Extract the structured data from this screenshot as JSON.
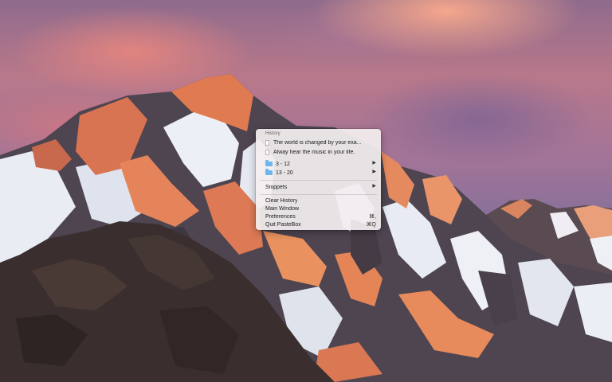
{
  "menu": {
    "header": "History",
    "history_items": [
      {
        "label": "The world is changed by your exa...",
        "icon": "document-icon"
      },
      {
        "label": "Alway hear the music in your life.",
        "icon": "document-icon"
      }
    ],
    "folders": [
      {
        "label": "3 - 12",
        "icon": "folder-icon",
        "submenu_arrow": "▶"
      },
      {
        "label": "13 - 20",
        "icon": "folder-icon",
        "submenu_arrow": "▶"
      }
    ],
    "snippets": {
      "label": "Snippets",
      "submenu_arrow": "▶"
    },
    "actions": [
      {
        "label": "Clear History",
        "shortcut": ""
      },
      {
        "label": "Main Window",
        "shortcut": ""
      },
      {
        "label": "Preferences",
        "shortcut": "⌘,"
      },
      {
        "label": "Quit PasteBox",
        "shortcut": "⌘Q"
      }
    ]
  },
  "colors": {
    "folder": "#6cb8ee",
    "menu_background": "#f3eef0"
  }
}
